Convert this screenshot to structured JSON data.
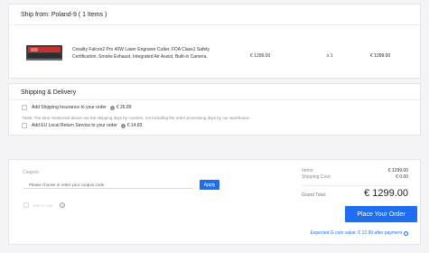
{
  "shipment": {
    "title": "Ship from: Poland-9 ( 1 Items )",
    "product": {
      "name": "Creality Falcon2 Pro 40W Laser Engraver Cutter, FDA Class1 Safety Certification, Smoke Exhaust, Integrated Air Assist, Built-in Camera,",
      "price": "€ 1299.00",
      "qty": "x 1",
      "total": "€ 1299.00"
    }
  },
  "delivery": {
    "title": "Shipping & Delivery",
    "insurance_label": "Add Shipping Insurance to your order",
    "insurance_price": "€ 26.89",
    "note": "*Note: The time mentioned above are the shipping days by couriers, not including the order processing days by our warehouse.",
    "return_label": "Add EU Local Return Service to your order",
    "return_price": "€ 14.83"
  },
  "summary": {
    "coupon_label": "Coupon:",
    "coupon_placeholder": "Please choose or enter your coupon code",
    "apply_label": "Apply",
    "gcoin_label": "Use G coin",
    "items_label": "Items:",
    "items_value": "€ 1299.00",
    "shipping_label": "Shipping Cost:",
    "shipping_value": "€ 0.00",
    "grand_label": "Grand Total:",
    "grand_value": "€ 1299.00",
    "place_order_label": "Place Your Order",
    "gcoin_note": "Expected G coin value: € 12.99 after payment"
  },
  "colors": {
    "accent": "#1f6ef0",
    "background": "#f4f4f6"
  }
}
